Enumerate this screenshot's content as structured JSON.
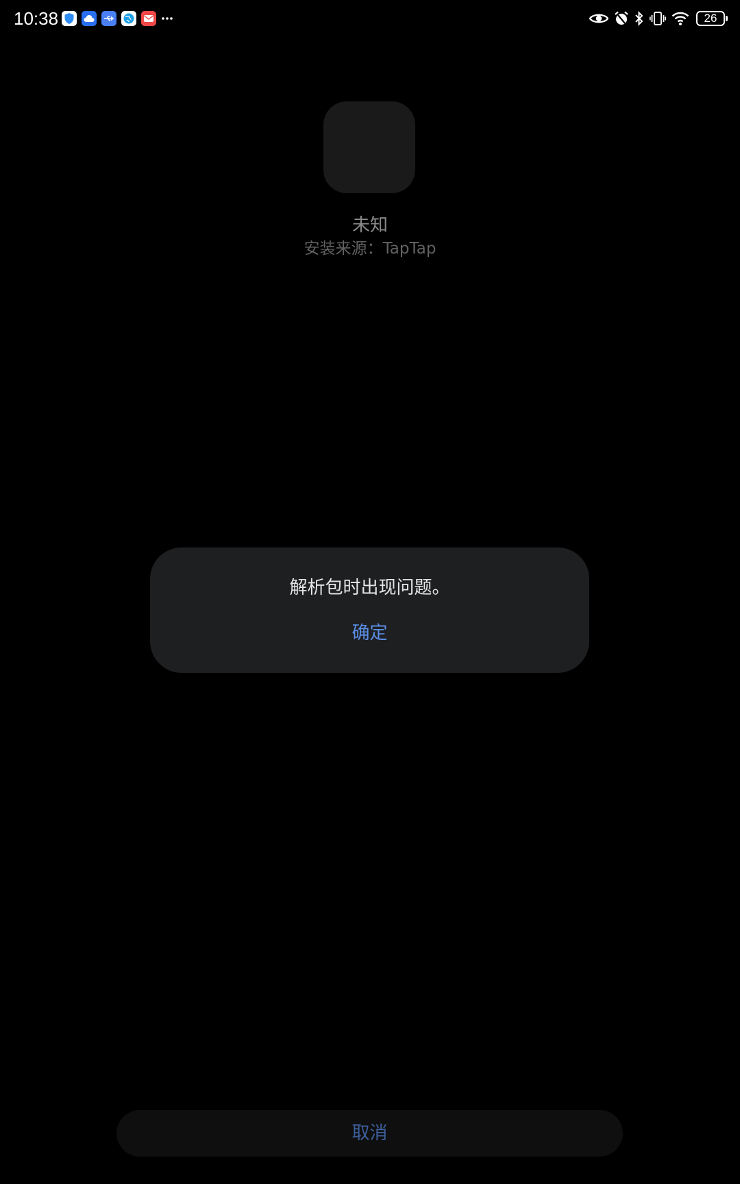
{
  "status_bar": {
    "time": "10:38",
    "notifications": [
      {
        "icon": "shield-icon",
        "color": "#2f8cf3"
      },
      {
        "icon": "cloud-icon",
        "color": "#2a6ff0"
      },
      {
        "icon": "usb-icon",
        "color": "#4a7ff5"
      },
      {
        "icon": "globe-icon",
        "color": "#1ea0e8"
      },
      {
        "icon": "mail-icon",
        "color": "#f04848"
      }
    ],
    "system_icons": [
      "eye-icon",
      "alarm-icon",
      "bluetooth-icon",
      "vibrate-icon",
      "wifi-icon"
    ],
    "battery_level": "26"
  },
  "app": {
    "name": "未知",
    "install_source": "安装来源：TapTap"
  },
  "dialog": {
    "message": "解析包时出现问题。",
    "confirm_label": "确定"
  },
  "footer": {
    "cancel_label": "取消"
  },
  "colors": {
    "background": "#000000",
    "dialog_background": "#1e1f21",
    "accent": "#5b8fe6",
    "accent_dim": "#3d5f9c"
  }
}
